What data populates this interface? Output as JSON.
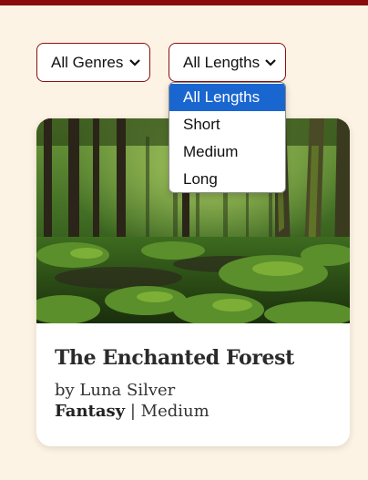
{
  "filters": {
    "genre": {
      "selected": "All Genres"
    },
    "length": {
      "selected": "All Lengths",
      "options": [
        "All Lengths",
        "Short",
        "Medium",
        "Long"
      ],
      "highlighted_index": 0
    }
  },
  "book": {
    "title": "The Enchanted Forest",
    "author": "by Luna Silver",
    "genre": "Fantasy",
    "separator": " | ",
    "length": "Medium"
  },
  "colors": {
    "background": "#fdf3e4",
    "accent": "#8b0a0a",
    "highlight": "#1a66d1"
  },
  "icons": {
    "select_arrow": "chevron-down-icon"
  }
}
